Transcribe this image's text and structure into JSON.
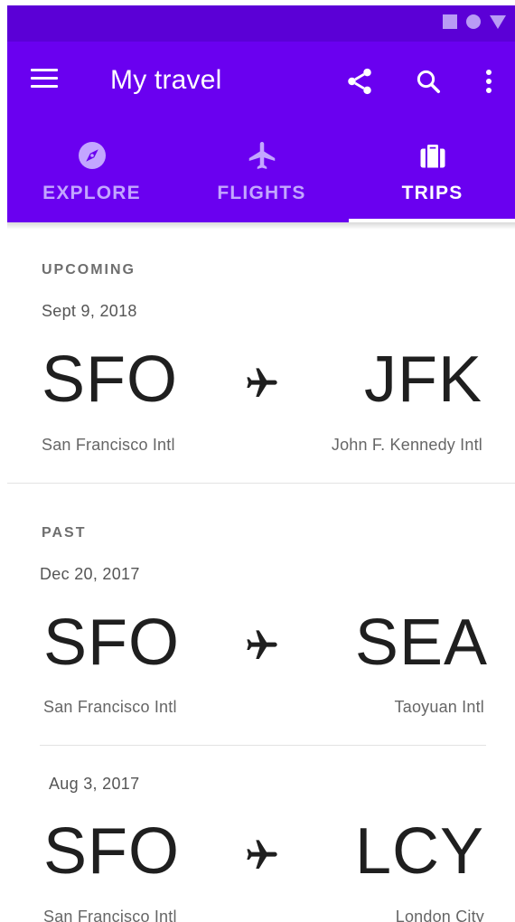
{
  "app": {
    "title": "My travel",
    "accent_color": "#6a00f0",
    "status_bar_color": "#5b00d6"
  },
  "status_bar": {
    "icons": [
      "square-icon",
      "circle-icon",
      "triangle-icon"
    ]
  },
  "toolbar": {
    "menu_icon": "menu-icon",
    "actions": [
      "share-icon",
      "search-icon",
      "more-vert-icon"
    ]
  },
  "tabs": [
    {
      "label": "EXPLORE",
      "icon": "compass-icon",
      "selected": false
    },
    {
      "label": "FLIGHTS",
      "icon": "airplane-icon",
      "selected": false
    },
    {
      "label": "TRIPS",
      "icon": "suitcase-icon",
      "selected": true
    }
  ],
  "sections": {
    "upcoming": {
      "label": "UPCOMING",
      "trips": [
        {
          "date": "Sept 9, 2018",
          "from_code": "SFO",
          "to_code": "JFK",
          "from_name": "San Francisco Intl",
          "to_name": "John F. Kennedy Intl"
        }
      ]
    },
    "past": {
      "label": "PAST",
      "trips": [
        {
          "date": "Dec 20, 2017",
          "from_code": "SFO",
          "to_code": "SEA",
          "from_name": "San Francisco Intl",
          "to_name": "Taoyuan Intl"
        },
        {
          "date": "Aug 3, 2017",
          "from_code": "SFO",
          "to_code": "LCY",
          "from_name": "San Francisco Intl",
          "to_name": "London City"
        }
      ]
    }
  }
}
